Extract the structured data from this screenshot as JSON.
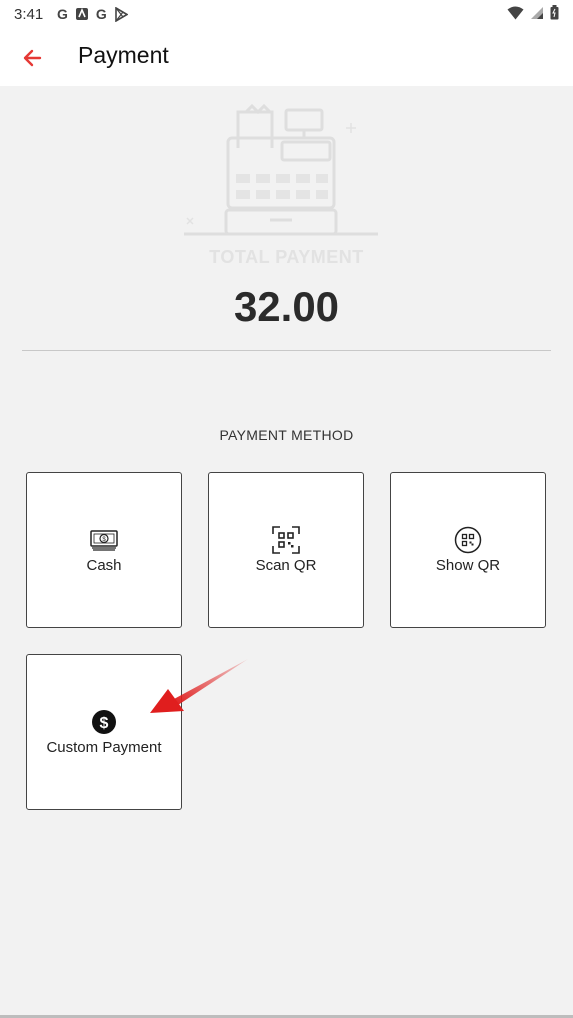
{
  "status_bar": {
    "time": "3:41",
    "left_icons": [
      "google-g-icon",
      "news-icon",
      "google-g-icon",
      "play-store-icon"
    ],
    "right_icons": [
      "wifi-icon",
      "signal-icon",
      "battery-icon"
    ]
  },
  "header": {
    "title": "Payment",
    "accent_color": "#e53935"
  },
  "summary": {
    "label": "TOTAL PAYMENT",
    "amount": "32.00",
    "illustration": "cash-register-icon"
  },
  "payment_methods": {
    "section_label": "PAYMENT METHOD",
    "items": [
      {
        "label": "Cash",
        "icon": "cash-icon"
      },
      {
        "label": "Scan QR",
        "icon": "scan-qr-icon"
      },
      {
        "label": "Show QR",
        "icon": "show-qr-icon"
      },
      {
        "label": "Custom Payment",
        "icon": "dollar-circle-icon"
      }
    ]
  },
  "annotation": {
    "icon": "red-arrow-icon",
    "color": "#e01e1e"
  }
}
